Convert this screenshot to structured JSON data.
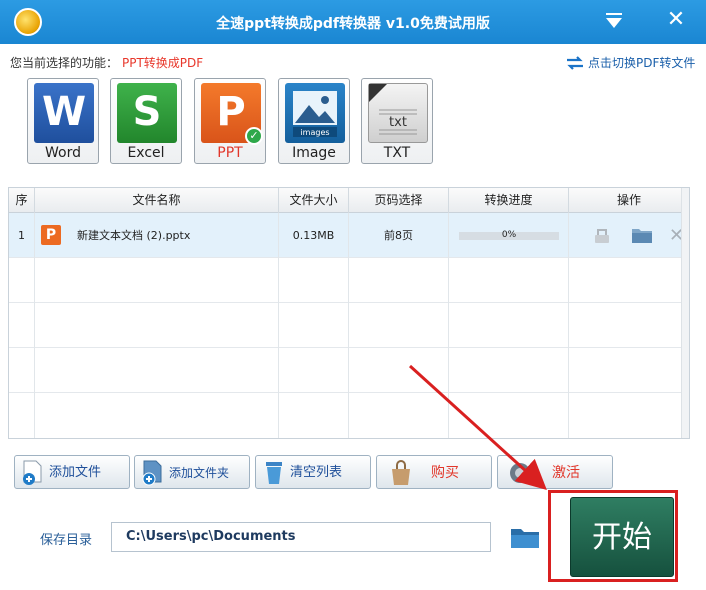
{
  "window": {
    "title": "全速ppt转换成pdf转换器 v1.0免费试用版"
  },
  "function_bar": {
    "label": "您当前选择的功能：",
    "value": "PPT转换成PDF",
    "switch_link": "点击切换PDF转文件"
  },
  "formats": [
    {
      "caption": "Word",
      "letter": "W",
      "color": "#2b5fb4",
      "selected": false
    },
    {
      "caption": "Excel",
      "letter": "S",
      "color": "#2f9a3c",
      "selected": false
    },
    {
      "caption": "PPT",
      "letter": "P",
      "color": "#e8661f",
      "selected": true
    },
    {
      "caption": "Image",
      "letter": "",
      "badge": "images",
      "color": "#1b6fb0",
      "selected": false
    },
    {
      "caption": "TXT",
      "letter": "",
      "badge": "txt",
      "color": "#d8d8d8",
      "selected": false
    }
  ],
  "table": {
    "headers": [
      "序",
      "文件名称",
      "文件大小",
      "页码选择",
      "转换进度",
      "操作"
    ],
    "rows": [
      {
        "index": "1",
        "name": "新建文本文档 (2).pptx",
        "size": "0.13MB",
        "pages": "前8页",
        "progress_text": "0%",
        "progress": 0
      }
    ]
  },
  "actions": {
    "add_file": "添加文件",
    "add_folder": "添加文件夹",
    "clear_list": "清空列表",
    "buy": "购买",
    "activate": "激活"
  },
  "save": {
    "label": "保存目录",
    "path": "C:\\Users\\pc\\Documents"
  },
  "start": {
    "label": "开始"
  },
  "colors": {
    "titlebar": "#1f8fd9",
    "accent_red": "#e1372b",
    "start": "#1f6a50"
  }
}
